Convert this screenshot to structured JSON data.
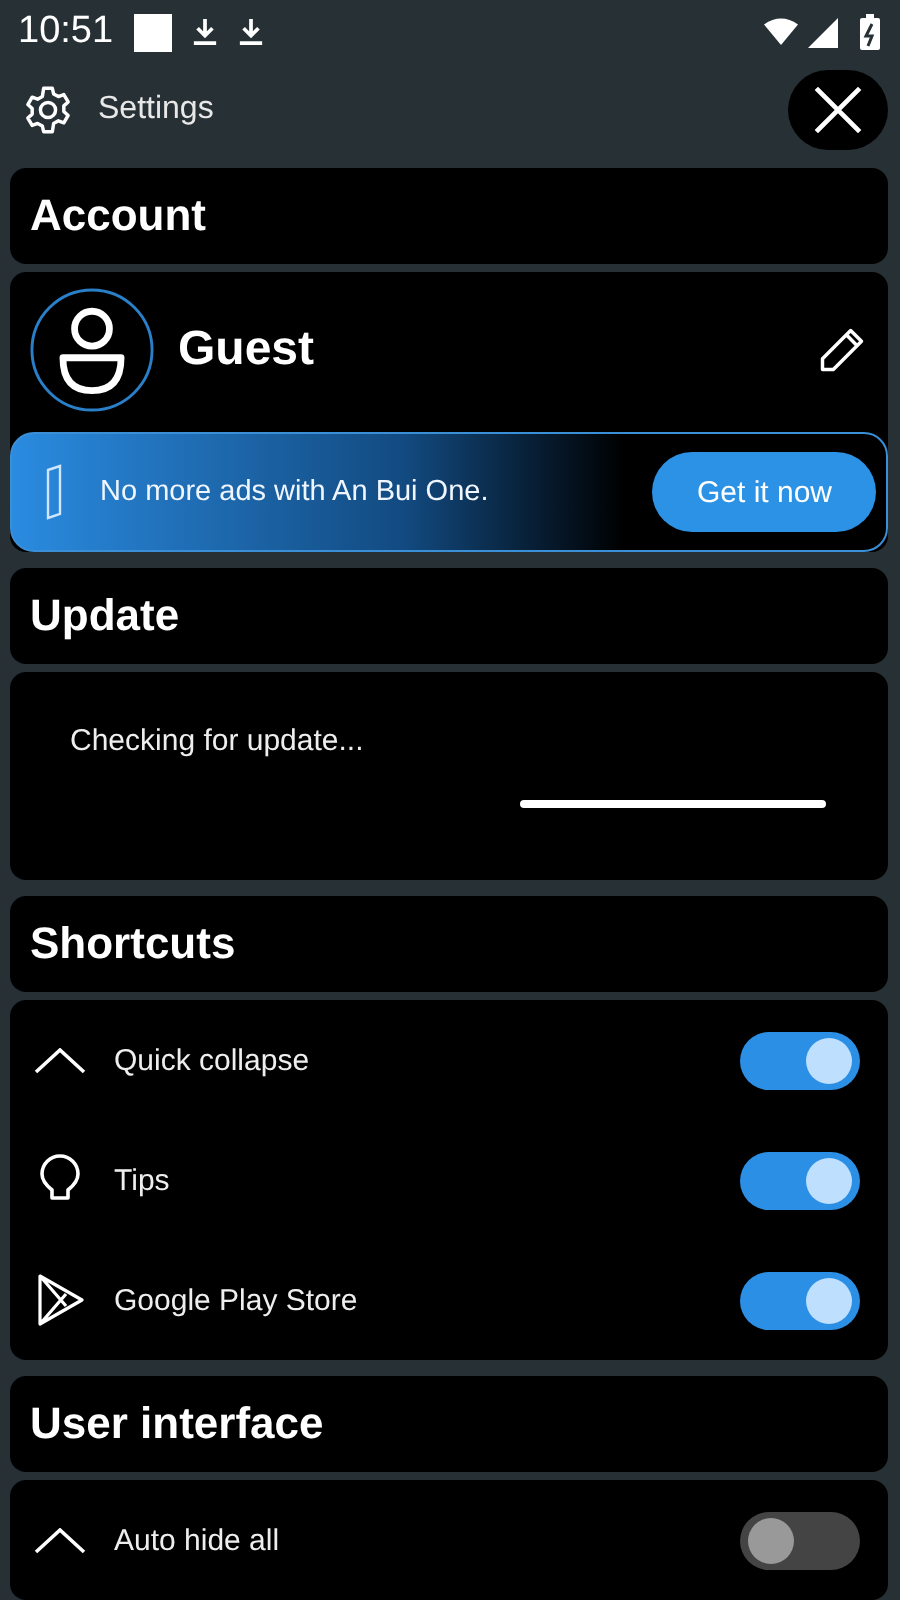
{
  "status_bar": {
    "time": "10:51"
  },
  "header": {
    "title": "Settings"
  },
  "sections": [
    {
      "kind": "account",
      "title": "Account",
      "user": "Guest",
      "promo": {
        "text": "No more ads with An Bui One.",
        "button": "Get it now"
      }
    },
    {
      "kind": "update",
      "title": "Update",
      "message": "Checking for update..."
    },
    {
      "kind": "toggles",
      "title": "Shortcuts",
      "items": [
        {
          "label": "Quick collapse",
          "on": true
        },
        {
          "label": "Tips",
          "on": true
        },
        {
          "label": "Google Play Store",
          "on": true
        }
      ]
    },
    {
      "kind": "toggles",
      "title": "User interface",
      "items": [
        {
          "label": "Auto hide all",
          "on": false
        }
      ]
    }
  ]
}
